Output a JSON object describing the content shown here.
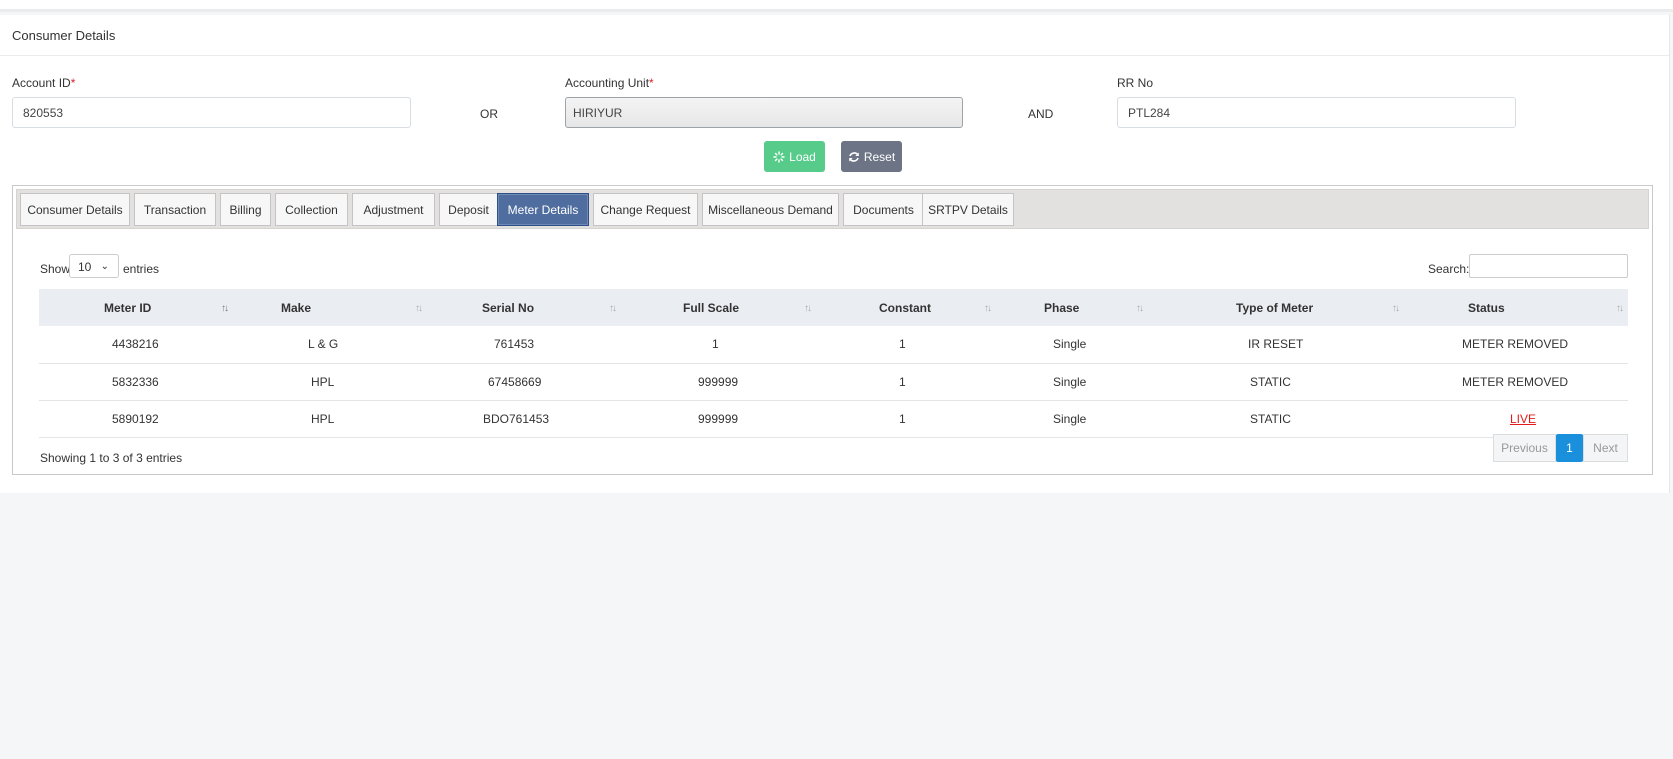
{
  "header": {
    "title": "Consumer Details"
  },
  "form": {
    "account_id_label": "Account ID",
    "account_id_value": "820553",
    "or_text": "OR",
    "accounting_unit_label": "Accounting Unit",
    "accounting_unit_value": "HIRIYUR",
    "and_text": "AND",
    "rr_no_label": "RR No",
    "rr_no_value": "PTL284",
    "required_mark": "*",
    "load_label": "Load",
    "reset_label": "Reset"
  },
  "tabs": [
    {
      "label": "Consumer Details"
    },
    {
      "label": "Transaction"
    },
    {
      "label": "Billing"
    },
    {
      "label": "Collection"
    },
    {
      "label": "Adjustment"
    },
    {
      "label": "Deposit"
    },
    {
      "label": "Meter Details",
      "active": true
    },
    {
      "label": "Change Request"
    },
    {
      "label": "Miscellaneous Demand"
    },
    {
      "label": "Documents"
    },
    {
      "label": "SRTPV Details"
    }
  ],
  "table_controls": {
    "show_label": "Show",
    "page_size": "10",
    "entries_label": "entries",
    "search_label": "Search:"
  },
  "table": {
    "columns": [
      "Meter ID",
      "Make",
      "Serial No",
      "Full Scale",
      "Constant",
      "Phase",
      "Type of Meter",
      "Status"
    ],
    "rows": [
      [
        "4438216",
        "L & G",
        "761453",
        "1",
        "1",
        "Single",
        "IR RESET",
        "METER REMOVED"
      ],
      [
        "5832336",
        "HPL",
        "67458669",
        "999999",
        "1",
        "Single",
        "STATIC",
        "METER REMOVED"
      ],
      [
        "5890192",
        "HPL",
        "BDO761453",
        "999999",
        "1",
        "Single",
        "STATIC",
        "LIVE"
      ]
    ]
  },
  "footer": {
    "info": "Showing 1 to 3 of 3 entries",
    "previous_label": "Previous",
    "current_page": "1",
    "next_label": "Next"
  },
  "colors": {
    "load_button": "#57cc8a",
    "reset_button": "#6c7485",
    "active_tab": "#4f6e9f",
    "live_status": "#e51b1b",
    "current_page": "#1a8fdc"
  }
}
